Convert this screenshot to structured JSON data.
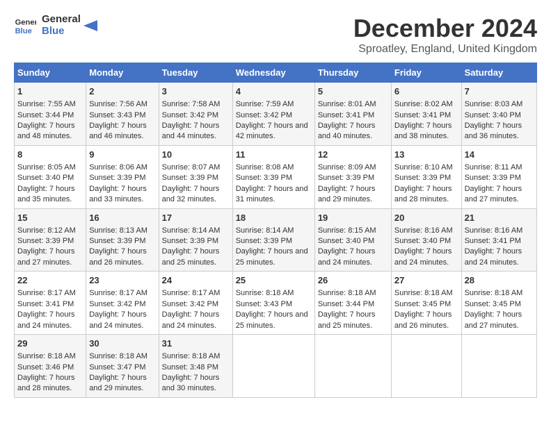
{
  "logo": {
    "line1": "General",
    "line2": "Blue"
  },
  "title": "December 2024",
  "subtitle": "Sproatley, England, United Kingdom",
  "days_of_week": [
    "Sunday",
    "Monday",
    "Tuesday",
    "Wednesday",
    "Thursday",
    "Friday",
    "Saturday"
  ],
  "weeks": [
    [
      {
        "day": "1",
        "sunrise": "Sunrise: 7:55 AM",
        "sunset": "Sunset: 3:44 PM",
        "daylight": "Daylight: 7 hours and 48 minutes."
      },
      {
        "day": "2",
        "sunrise": "Sunrise: 7:56 AM",
        "sunset": "Sunset: 3:43 PM",
        "daylight": "Daylight: 7 hours and 46 minutes."
      },
      {
        "day": "3",
        "sunrise": "Sunrise: 7:58 AM",
        "sunset": "Sunset: 3:42 PM",
        "daylight": "Daylight: 7 hours and 44 minutes."
      },
      {
        "day": "4",
        "sunrise": "Sunrise: 7:59 AM",
        "sunset": "Sunset: 3:42 PM",
        "daylight": "Daylight: 7 hours and 42 minutes."
      },
      {
        "day": "5",
        "sunrise": "Sunrise: 8:01 AM",
        "sunset": "Sunset: 3:41 PM",
        "daylight": "Daylight: 7 hours and 40 minutes."
      },
      {
        "day": "6",
        "sunrise": "Sunrise: 8:02 AM",
        "sunset": "Sunset: 3:41 PM",
        "daylight": "Daylight: 7 hours and 38 minutes."
      },
      {
        "day": "7",
        "sunrise": "Sunrise: 8:03 AM",
        "sunset": "Sunset: 3:40 PM",
        "daylight": "Daylight: 7 hours and 36 minutes."
      }
    ],
    [
      {
        "day": "8",
        "sunrise": "Sunrise: 8:05 AM",
        "sunset": "Sunset: 3:40 PM",
        "daylight": "Daylight: 7 hours and 35 minutes."
      },
      {
        "day": "9",
        "sunrise": "Sunrise: 8:06 AM",
        "sunset": "Sunset: 3:39 PM",
        "daylight": "Daylight: 7 hours and 33 minutes."
      },
      {
        "day": "10",
        "sunrise": "Sunrise: 8:07 AM",
        "sunset": "Sunset: 3:39 PM",
        "daylight": "Daylight: 7 hours and 32 minutes."
      },
      {
        "day": "11",
        "sunrise": "Sunrise: 8:08 AM",
        "sunset": "Sunset: 3:39 PM",
        "daylight": "Daylight: 7 hours and 31 minutes."
      },
      {
        "day": "12",
        "sunrise": "Sunrise: 8:09 AM",
        "sunset": "Sunset: 3:39 PM",
        "daylight": "Daylight: 7 hours and 29 minutes."
      },
      {
        "day": "13",
        "sunrise": "Sunrise: 8:10 AM",
        "sunset": "Sunset: 3:39 PM",
        "daylight": "Daylight: 7 hours and 28 minutes."
      },
      {
        "day": "14",
        "sunrise": "Sunrise: 8:11 AM",
        "sunset": "Sunset: 3:39 PM",
        "daylight": "Daylight: 7 hours and 27 minutes."
      }
    ],
    [
      {
        "day": "15",
        "sunrise": "Sunrise: 8:12 AM",
        "sunset": "Sunset: 3:39 PM",
        "daylight": "Daylight: 7 hours and 27 minutes."
      },
      {
        "day": "16",
        "sunrise": "Sunrise: 8:13 AM",
        "sunset": "Sunset: 3:39 PM",
        "daylight": "Daylight: 7 hours and 26 minutes."
      },
      {
        "day": "17",
        "sunrise": "Sunrise: 8:14 AM",
        "sunset": "Sunset: 3:39 PM",
        "daylight": "Daylight: 7 hours and 25 minutes."
      },
      {
        "day": "18",
        "sunrise": "Sunrise: 8:14 AM",
        "sunset": "Sunset: 3:39 PM",
        "daylight": "Daylight: 7 hours and 25 minutes."
      },
      {
        "day": "19",
        "sunrise": "Sunrise: 8:15 AM",
        "sunset": "Sunset: 3:40 PM",
        "daylight": "Daylight: 7 hours and 24 minutes."
      },
      {
        "day": "20",
        "sunrise": "Sunrise: 8:16 AM",
        "sunset": "Sunset: 3:40 PM",
        "daylight": "Daylight: 7 hours and 24 minutes."
      },
      {
        "day": "21",
        "sunrise": "Sunrise: 8:16 AM",
        "sunset": "Sunset: 3:41 PM",
        "daylight": "Daylight: 7 hours and 24 minutes."
      }
    ],
    [
      {
        "day": "22",
        "sunrise": "Sunrise: 8:17 AM",
        "sunset": "Sunset: 3:41 PM",
        "daylight": "Daylight: 7 hours and 24 minutes."
      },
      {
        "day": "23",
        "sunrise": "Sunrise: 8:17 AM",
        "sunset": "Sunset: 3:42 PM",
        "daylight": "Daylight: 7 hours and 24 minutes."
      },
      {
        "day": "24",
        "sunrise": "Sunrise: 8:17 AM",
        "sunset": "Sunset: 3:42 PM",
        "daylight": "Daylight: 7 hours and 24 minutes."
      },
      {
        "day": "25",
        "sunrise": "Sunrise: 8:18 AM",
        "sunset": "Sunset: 3:43 PM",
        "daylight": "Daylight: 7 hours and 25 minutes."
      },
      {
        "day": "26",
        "sunrise": "Sunrise: 8:18 AM",
        "sunset": "Sunset: 3:44 PM",
        "daylight": "Daylight: 7 hours and 25 minutes."
      },
      {
        "day": "27",
        "sunrise": "Sunrise: 8:18 AM",
        "sunset": "Sunset: 3:45 PM",
        "daylight": "Daylight: 7 hours and 26 minutes."
      },
      {
        "day": "28",
        "sunrise": "Sunrise: 8:18 AM",
        "sunset": "Sunset: 3:45 PM",
        "daylight": "Daylight: 7 hours and 27 minutes."
      }
    ],
    [
      {
        "day": "29",
        "sunrise": "Sunrise: 8:18 AM",
        "sunset": "Sunset: 3:46 PM",
        "daylight": "Daylight: 7 hours and 28 minutes."
      },
      {
        "day": "30",
        "sunrise": "Sunrise: 8:18 AM",
        "sunset": "Sunset: 3:47 PM",
        "daylight": "Daylight: 7 hours and 29 minutes."
      },
      {
        "day": "31",
        "sunrise": "Sunrise: 8:18 AM",
        "sunset": "Sunset: 3:48 PM",
        "daylight": "Daylight: 7 hours and 30 minutes."
      },
      null,
      null,
      null,
      null
    ]
  ]
}
